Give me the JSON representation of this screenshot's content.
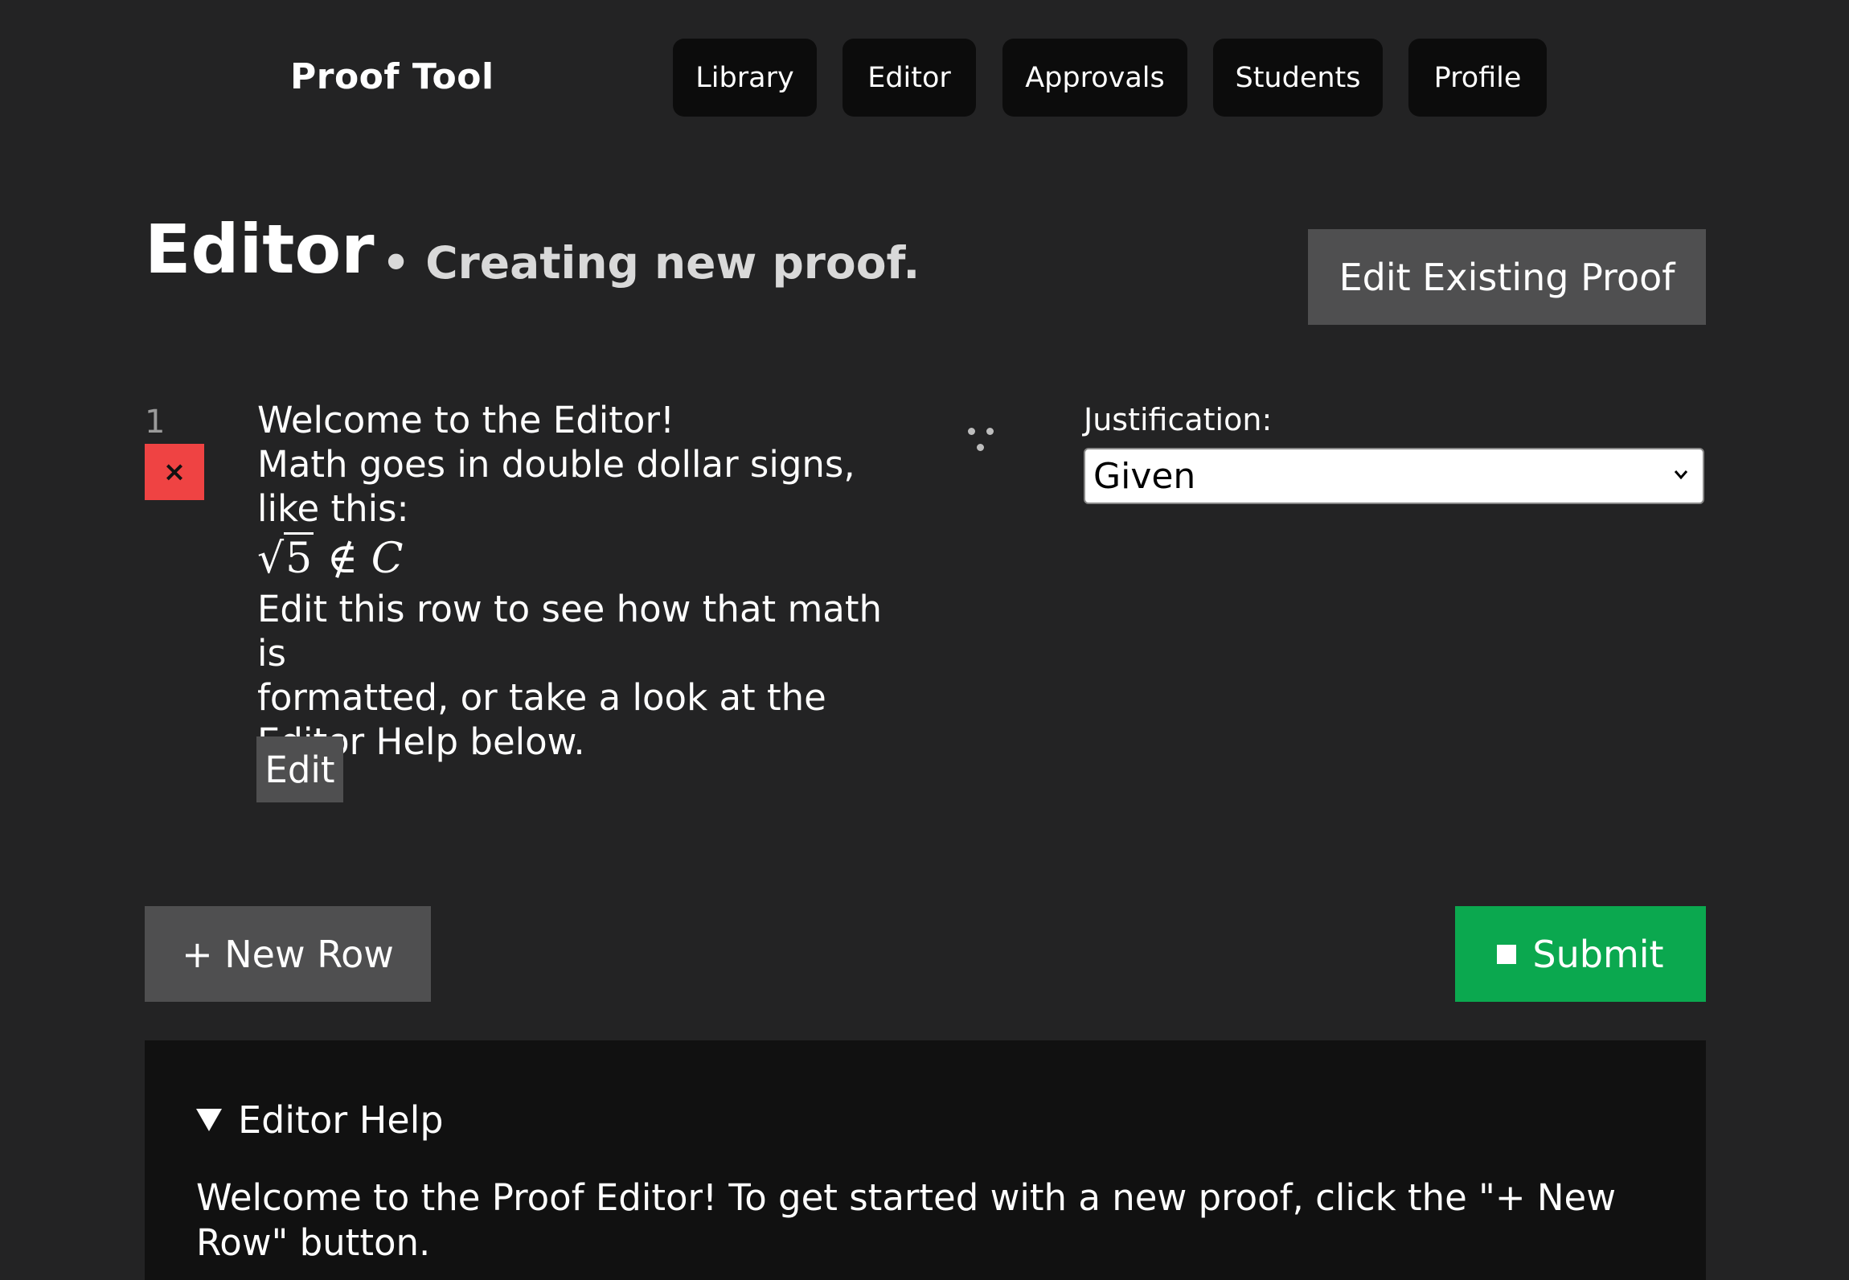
{
  "header": {
    "brand": "Proof Tool",
    "nav": [
      {
        "label": "Library"
      },
      {
        "label": "Editor"
      },
      {
        "label": "Approvals"
      },
      {
        "label": "Students"
      },
      {
        "label": "Profile"
      }
    ]
  },
  "page": {
    "title": "Editor",
    "subtitle": "• Creating new proof.",
    "edit_existing_label": "Edit Existing Proof"
  },
  "proof_rows": [
    {
      "number": "1",
      "delete_label": "×",
      "text_lines": [
        "Welcome to the Editor!",
        "Math goes in double dollar signs,",
        "like this:"
      ],
      "math": {
        "radicand": "5",
        "relation": "∉",
        "set": "C"
      },
      "text_after": [
        "Edit this row to see how that math is",
        "formatted, or take a look at the",
        "Editor Help below."
      ],
      "edit_label": "Edit",
      "justification_label": "Justification:",
      "justification_value": "Given"
    }
  ],
  "actions": {
    "new_row_label": "+ New Row",
    "submit_label": "Submit"
  },
  "help": {
    "summary": "Editor Help",
    "body": "Welcome to the Proof Editor! To get started with a new proof, click the \"+ New Row\" button."
  },
  "colors": {
    "background": "#232324",
    "delete": "#ef4343",
    "submit": "#0ba84f",
    "button_gray": "#4f4f50",
    "help_panel": "#111111"
  }
}
